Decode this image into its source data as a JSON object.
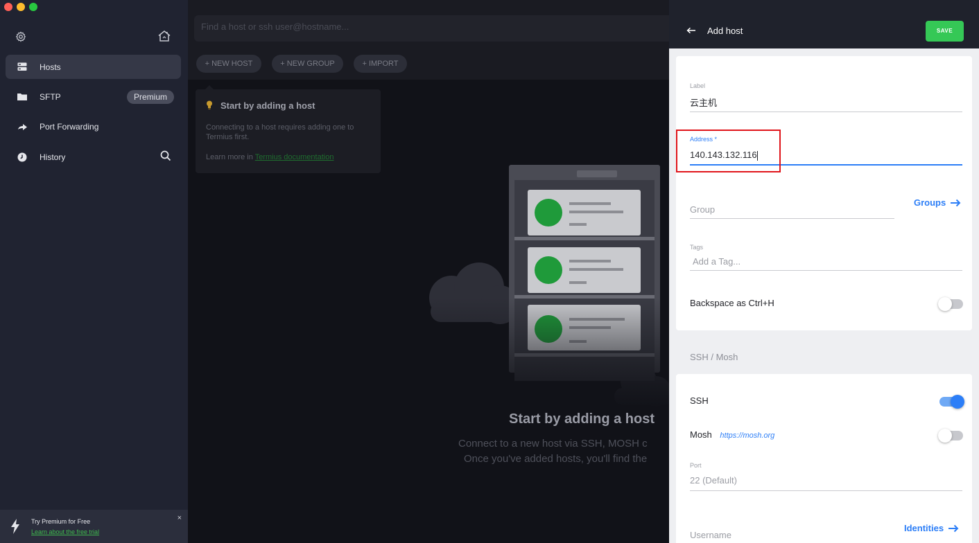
{
  "window": {
    "controls": [
      "close",
      "minimize",
      "zoom"
    ]
  },
  "colors": {
    "accent_green": "#35c856",
    "accent_blue": "#2c7ef7",
    "highlight_red": "#e0141a",
    "sidebar_bg": "#202331"
  },
  "sidebar": {
    "settings_icon": "gear-icon",
    "home_icon": "house-icon",
    "items": [
      {
        "label": "Hosts",
        "icon": "server-icon",
        "active": true
      },
      {
        "label": "SFTP",
        "icon": "folder-icon",
        "badge": "Premium"
      },
      {
        "label": "Port Forwarding",
        "icon": "forward-arrow-icon"
      },
      {
        "label": "History",
        "icon": "clock-icon"
      }
    ],
    "promo": {
      "title": "Try Premium for Free",
      "link": "Learn about the free trial",
      "close": "×"
    }
  },
  "main": {
    "search": {
      "placeholder": "Find a host or ssh user@hostname..."
    },
    "toolbar": {
      "new_host": "+ NEW HOST",
      "new_group": "+ NEW GROUP",
      "import": "+ IMPORT"
    },
    "tip": {
      "title": "Start by adding a host",
      "body": "Connecting to a host requires adding one to Termius first.",
      "learn_prefix": "Learn more in ",
      "learn_link": "Termius documentation"
    },
    "empty": {
      "title": "Start by adding a host",
      "line1": "Connect to a new host via SSH, MOSH c",
      "line2": "Once you've added hosts, you'll find the"
    }
  },
  "panel": {
    "title": "Add host",
    "save": "SAVE",
    "label": {
      "label": "Label",
      "value": "云主机"
    },
    "address": {
      "label": "Address *",
      "value": "140.143.132.116"
    },
    "group": {
      "placeholder": "Group",
      "link": "Groups"
    },
    "tags": {
      "label": "Tags",
      "placeholder": "Add a Tag..."
    },
    "backspace": {
      "label": "Backspace as Ctrl+H",
      "enabled": false
    },
    "section": "SSH / Mosh",
    "ssh": {
      "label": "SSH",
      "enabled": true
    },
    "mosh": {
      "label": "Mosh",
      "link": "https://mosh.org",
      "enabled": false
    },
    "port": {
      "label": "Port",
      "placeholder": "22 (Default)"
    },
    "username": {
      "placeholder": "Username",
      "link": "Identities"
    }
  }
}
